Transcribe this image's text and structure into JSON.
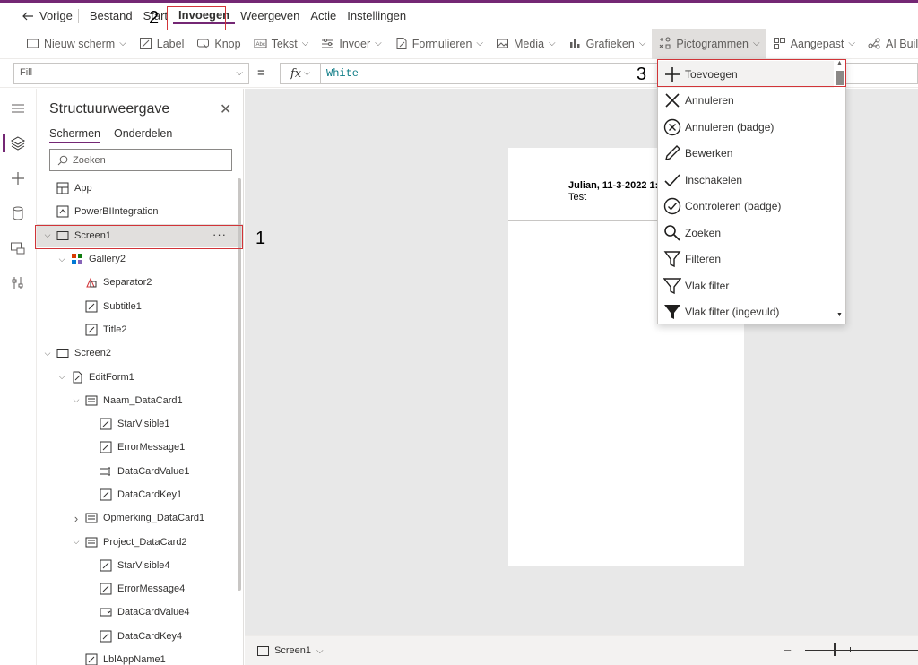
{
  "menubar": {
    "back_label": "Vorige",
    "items": [
      "Bestand",
      "Start",
      "Invoegen",
      "Weergeven",
      "Actie",
      "Instellingen"
    ],
    "active_item": "Invoegen"
  },
  "toolbar": {
    "new_screen": "Nieuw scherm",
    "label": "Label",
    "button": "Knop",
    "text": "Tekst",
    "input": "Invoer",
    "forms": "Formulieren",
    "media": "Media",
    "charts": "Grafieken",
    "icons": "Pictogrammen",
    "custom": "Aangepast",
    "ai_builder": "AI Builder"
  },
  "formula": {
    "property": "Fill",
    "equals": "=",
    "fx": "fx",
    "value": "White"
  },
  "tree_panel": {
    "title": "Structuurweergave",
    "tabs": [
      "Schermen",
      "Onderdelen"
    ],
    "search_placeholder": "Zoeken",
    "items": [
      {
        "label": "App",
        "icon": "app-icon",
        "indent": 0,
        "twist": ""
      },
      {
        "label": "PowerBIIntegration",
        "icon": "powerbi-icon",
        "indent": 0,
        "twist": ""
      },
      {
        "label": "Screen1",
        "icon": "screen-icon",
        "indent": 0,
        "twist": "v",
        "selected": true
      },
      {
        "label": "Gallery2",
        "icon": "gallery-icon",
        "indent": 1,
        "twist": "v"
      },
      {
        "label": "Separator2",
        "icon": "shape-icon",
        "indent": 2,
        "twist": ""
      },
      {
        "label": "Subtitle1",
        "icon": "label-icon",
        "indent": 2,
        "twist": ""
      },
      {
        "label": "Title2",
        "icon": "label-icon",
        "indent": 2,
        "twist": ""
      },
      {
        "label": "Screen2",
        "icon": "screen-icon",
        "indent": 0,
        "twist": "v"
      },
      {
        "label": "EditForm1",
        "icon": "form-icon",
        "indent": 1,
        "twist": "v"
      },
      {
        "label": "Naam_DataCard1",
        "icon": "datacard-icon",
        "indent": 2,
        "twist": "v"
      },
      {
        "label": "StarVisible1",
        "icon": "label-icon",
        "indent": 3,
        "twist": ""
      },
      {
        "label": "ErrorMessage1",
        "icon": "label-icon",
        "indent": 3,
        "twist": ""
      },
      {
        "label": "DataCardValue1",
        "icon": "textinput-icon",
        "indent": 3,
        "twist": ""
      },
      {
        "label": "DataCardKey1",
        "icon": "label-icon",
        "indent": 3,
        "twist": ""
      },
      {
        "label": "Opmerking_DataCard1",
        "icon": "datacard-icon",
        "indent": 2,
        "twist": ">"
      },
      {
        "label": "Project_DataCard2",
        "icon": "datacard-icon",
        "indent": 2,
        "twist": "v"
      },
      {
        "label": "StarVisible4",
        "icon": "label-icon",
        "indent": 3,
        "twist": ""
      },
      {
        "label": "ErrorMessage4",
        "icon": "label-icon",
        "indent": 3,
        "twist": ""
      },
      {
        "label": "DataCardValue4",
        "icon": "dropdown-icon",
        "indent": 3,
        "twist": ""
      },
      {
        "label": "DataCardKey4",
        "icon": "label-icon",
        "indent": 3,
        "twist": ""
      },
      {
        "label": "LblAppName1",
        "icon": "label-icon",
        "indent": 2,
        "twist": ""
      }
    ]
  },
  "canvas": {
    "title": "Julian, 11-3-2022 1:",
    "subtitle": "Test"
  },
  "statusbar": {
    "screen_selector": "Screen1",
    "zoom_minus": "–"
  },
  "icon_dropdown": {
    "items": [
      {
        "label": "Toevoegen",
        "icon": "add-icon"
      },
      {
        "label": "Annuleren",
        "icon": "cancel-icon"
      },
      {
        "label": "Annuleren (badge)",
        "icon": "cancel-badge-icon"
      },
      {
        "label": "Bewerken",
        "icon": "edit-icon"
      },
      {
        "label": "Inschakelen",
        "icon": "check-icon"
      },
      {
        "label": "Controleren (badge)",
        "icon": "check-badge-icon"
      },
      {
        "label": "Zoeken",
        "icon": "search-icon"
      },
      {
        "label": "Filteren",
        "icon": "filter-icon"
      },
      {
        "label": "Vlak filter",
        "icon": "flat-filter-icon"
      },
      {
        "label": "Vlak filter (ingevuld)",
        "icon": "flat-filter-filled-icon"
      }
    ]
  },
  "annotations": [
    "1",
    "2",
    "3"
  ],
  "colors": {
    "accent": "#742774",
    "highlight": "#d13438",
    "formula_text": "#0e7c86"
  }
}
